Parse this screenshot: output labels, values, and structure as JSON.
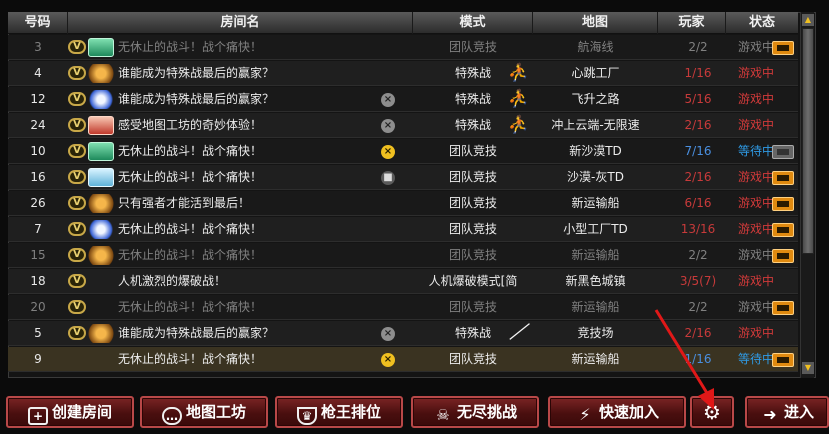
{
  "header": {
    "col_num": "号码",
    "col_name": "房间名",
    "col_mode": "模式",
    "col_map": "地图",
    "col_players": "玩家",
    "col_status": "状态"
  },
  "rows": [
    {
      "num": "3",
      "badge": "V",
      "rank_icon": "green-gift-icon",
      "name": "无休止的战斗！战个痛快！",
      "lock": "",
      "mode": "团队竞技",
      "mode_icon": "",
      "map": "航海线",
      "players": "2/2",
      "status": "游戏中",
      "tv": "orange",
      "dim": true
    },
    {
      "num": "4",
      "badge": "V",
      "rank_icon": "wing-icon",
      "name": "谁能成为特殊战最后的赢家？",
      "lock": "",
      "mode": "特殊战",
      "mode_icon": "runner-icon",
      "map": "心跳工厂",
      "players": "1/16",
      "status": "游戏中",
      "tv": "",
      "dim": false
    },
    {
      "num": "12",
      "badge": "V",
      "rank_icon": "blue-wing-icon",
      "name": "谁能成为特殊战最后的赢家？",
      "lock": "grey",
      "mode": "特殊战",
      "mode_icon": "runner-icon",
      "map": "飞升之路",
      "players": "5/16",
      "status": "游戏中",
      "tv": "",
      "dim": false
    },
    {
      "num": "24",
      "badge": "V",
      "rank_icon": "red-gift-icon",
      "name": "感受地图工坊的奇妙体验！",
      "lock": "grey",
      "mode": "特殊战",
      "mode_icon": "runner-icon",
      "map": "冲上云端-无限速",
      "players": "2/16",
      "status": "游戏中",
      "tv": "",
      "dim": false
    },
    {
      "num": "10",
      "badge": "V",
      "rank_icon": "green-gift-icon",
      "name": "无休止的战斗！战个痛快！",
      "lock": "yellow",
      "mode": "团队竞技",
      "mode_icon": "",
      "map": "新沙漠TD",
      "players": "7/16",
      "status": "等待中",
      "tv": "grey",
      "dim": false
    },
    {
      "num": "16",
      "badge": "V",
      "rank_icon": "blue-gift-icon",
      "name": "无休止的战斗！战个痛快！",
      "lock": "dark",
      "mode": "团队竞技",
      "mode_icon": "",
      "map": "沙漠-灰TD",
      "players": "2/16",
      "status": "游戏中",
      "tv": "orange",
      "dim": false
    },
    {
      "num": "26",
      "badge": "V",
      "rank_icon": "wing-icon",
      "name": "只有强者才能活到最后！",
      "lock": "",
      "mode": "团队竞技",
      "mode_icon": "",
      "map": "新运输船",
      "players": "6/16",
      "status": "游戏中",
      "tv": "orange",
      "dim": false
    },
    {
      "num": "7",
      "badge": "V",
      "rank_icon": "blue-wing-icon",
      "name": "无休止的战斗！战个痛快！",
      "lock": "",
      "mode": "团队竞技",
      "mode_icon": "",
      "map": "小型工厂TD",
      "players": "13/16",
      "status": "游戏中",
      "tv": "orange",
      "dim": false
    },
    {
      "num": "15",
      "badge": "V",
      "rank_icon": "wing-icon",
      "name": "无休止的战斗！战个痛快！",
      "lock": "",
      "mode": "团队竞技",
      "mode_icon": "",
      "map": "新运输船",
      "players": "2/2",
      "status": "游戏中",
      "tv": "orange",
      "dim": true
    },
    {
      "num": "18",
      "badge": "V",
      "rank_icon": "",
      "name": "人机激烈的爆破战！",
      "lock": "",
      "mode": "人机爆破模式[简",
      "mode_icon": "",
      "map": "新黑色城镇",
      "players": "3/5(7)",
      "status": "游戏中",
      "tv": "",
      "dim": false
    },
    {
      "num": "20",
      "badge": "V",
      "rank_icon": "",
      "name": "无休止的战斗！战个痛快！",
      "lock": "",
      "mode": "团队竞技",
      "mode_icon": "",
      "map": "新运输船",
      "players": "2/2",
      "status": "游戏中",
      "tv": "orange",
      "dim": true
    },
    {
      "num": "5",
      "badge": "V",
      "rank_icon": "wing-icon",
      "name": "谁能成为特殊战最后的赢家？",
      "lock": "grey",
      "mode": "特殊战",
      "mode_icon": "knife-icon",
      "map": "竞技场",
      "players": "2/16",
      "status": "游戏中",
      "tv": "",
      "dim": false
    },
    {
      "num": "9",
      "badge": "",
      "rank_icon": "",
      "name": "无休止的战斗！战个痛快！",
      "lock": "yellow",
      "mode": "团队竞技",
      "mode_icon": "",
      "map": "新运输船",
      "players": "1/16",
      "status": "等待中",
      "tv": "orange",
      "dim": false
    }
  ],
  "buttons": {
    "create_room": "创建房间",
    "map_workshop": "地图工坊",
    "gun_king_rank": "枪王排位",
    "endless_challenge": "无尽挑战",
    "quick_join": "快速加入",
    "enter": "进入"
  }
}
